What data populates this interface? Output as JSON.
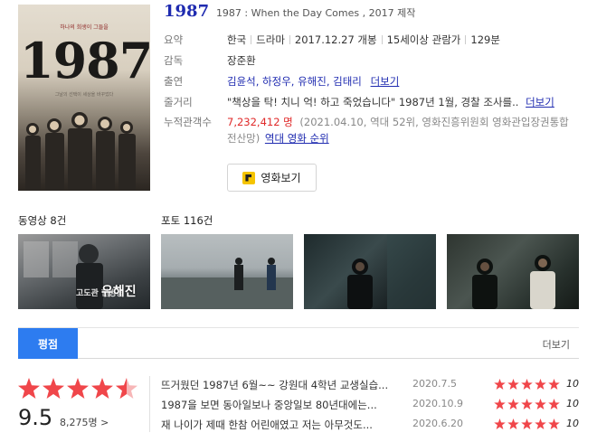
{
  "movie": {
    "title": "1987",
    "subtitle": "1987 : When the Day Comes , 2017 제작",
    "poster": {
      "big_number": "1987",
      "tagline": "하나의 희생이 그들을",
      "caption": "그날의 선택이 세상을 바꾸었다"
    },
    "summary_label": "요약",
    "summary": {
      "country": "한국",
      "genre": "드라마",
      "release": "2017.12.27 개봉",
      "rating": "15세이상 관람가",
      "runtime": "129분"
    },
    "director_label": "감독",
    "director": "장준환",
    "cast_label": "출연",
    "cast": "김윤석, 하정우, 유해진, 김태리",
    "cast_more": "더보기",
    "plot_label": "줄거리",
    "plot": "\"책상을 탁! 치니 억! 하고 죽었습니다\" 1987년 1월, 경찰 조사를..",
    "plot_more": "더보기",
    "audience_label": "누적관객수",
    "audience_count": "7,232,412 명",
    "audience_note": "(2021.04.10, 역대 52위, 영화진흥위원회 영화관입장권통합",
    "audience_note2": "전산망)",
    "audience_link": "역대 영화 순위",
    "watch_button": "영화보기"
  },
  "media": {
    "video_label": "동영상 8건",
    "photo_label": "포토 116건",
    "video_caption_small": "고도관 한병용",
    "video_caption_big": "유해진"
  },
  "ratings": {
    "tab_label": "평점",
    "more": "더보기",
    "score": "9.5",
    "votes": "8,275명 >",
    "reviews": [
      {
        "text": "뜨거웠던 1987년 6월~~ 강원대 4학년 교생실습...",
        "date": "2020.7.5",
        "score": "10"
      },
      {
        "text": "1987을 보면 동아일보나 중앙일보 80년대에는...",
        "date": "2020.10.9",
        "score": "10"
      },
      {
        "text": "재 나이가 제때 한참 어린애였고 저는 아무것도...",
        "date": "2020.6.20",
        "score": "10"
      }
    ]
  },
  "colors": {
    "accent": "#2d7cf0",
    "title_blue": "#1f2bb0",
    "star_red": "#f0464a",
    "count_red": "#e02a2a"
  }
}
